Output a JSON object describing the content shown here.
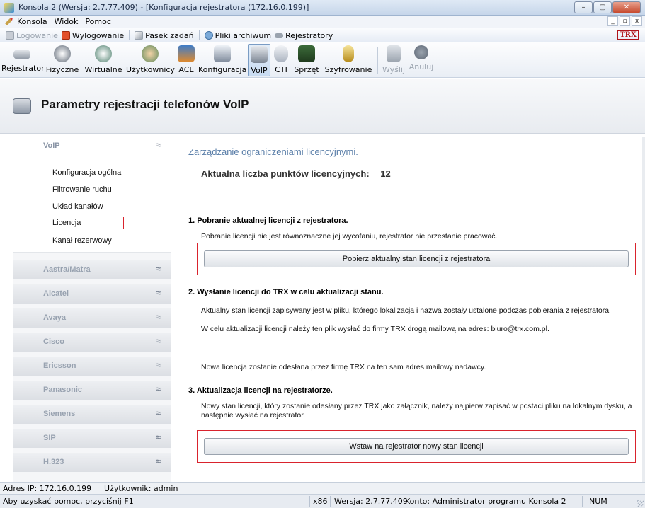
{
  "window": {
    "title": "Konsola 2 (Wersja: 2.7.77.409) - [Konfiguracja rejestratora (172.16.0.199)]",
    "buttons": [
      "–",
      "▢",
      "✕"
    ]
  },
  "menu": {
    "items": [
      "Konsola",
      "Widok",
      "Pomoc"
    ],
    "mdi_buttons": [
      "_",
      "▫",
      "x"
    ]
  },
  "quick_toolbar": {
    "login": "Logowanie",
    "logout": "Wylogowanie",
    "taskbar": "Pasek zadań",
    "archive": "Pliki archiwum",
    "recorders": "Rejestratory",
    "logo": "TRX"
  },
  "toolbar": {
    "rejestrator": "Rejestrator",
    "fizyczne": "Fizyczne",
    "wirtualne": "Wirtualne",
    "uzytkownicy": "Użytkownicy",
    "acl": "ACL",
    "konfiguracja": "Konfiguracja",
    "voip": "VoIP",
    "cti": "CTI",
    "sprzet": "Sprzęt",
    "szyfrowanie": "Szyfrowanie",
    "wyslij": "Wyślij",
    "anuluj": "Anuluj"
  },
  "header": {
    "title": "Parametry rejestracji telefonów VoIP"
  },
  "sidebar": {
    "open_group": "VoIP",
    "items": [
      "Konfiguracja ogólna",
      "Filtrowanie ruchu",
      "Układ kanałów",
      "Licencja",
      "Kanał rezerwowy"
    ],
    "selected": "Licencja",
    "groups": [
      "Aastra/Matra",
      "Alcatel",
      "Avaya",
      "Cisco",
      "Ericsson",
      "Panasonic",
      "Siemens",
      "SIP",
      "H.323"
    ],
    "collapse_glyph": "≈",
    "expand_glyph": "≈"
  },
  "main": {
    "title": "Zarządzanie ograniczeniami licencyjnymi.",
    "license_label": "Aktualna liczba punktów licencyjnych:",
    "license_value": "12",
    "sec1_title": "1. Pobranie aktualnej licencji z rejestratora.",
    "sec1_text": "Pobranie licencji nie jest równoznaczne jej wycofaniu, rejestrator nie przestanie pracować.",
    "btn_download": "Pobierz aktualny stan licencji z rejestratora",
    "sec2_title": "2. Wysłanie licencji do TRX w celu aktualizacji stanu.",
    "sec2_text1": "Aktualny stan licencji zapisywany jest w pliku, którego lokalizacja i nazwa zostały ustalone podczas pobierania z rejestratora.",
    "sec2_text2": "W celu aktualizacji licencji należy ten plik wysłać do firmy TRX drogą mailową na adres: biuro@trx.com.pl.",
    "sec2_text3": "Nowa licencja zostanie odesłana przez firmę TRX na ten sam adres mailowy nadawcy.",
    "sec3_title": "3. Aktualizacja licencji na rejestratorze.",
    "sec3_text": "Nowy stan licencji, który zostanie odesłany przez TRX jako załącznik, należy najpierw zapisać w postaci pliku na lokalnym dysku, a następnie wysłać na rejestrator.",
    "btn_upload": "Wstaw na rejestrator nowy stan licencji"
  },
  "status": {
    "ip": "Adres IP: 172.16.0.199",
    "user": "Użytkownik: admin",
    "help": "Aby uzyskać pomoc, przyciśnij F1",
    "arch": "x86",
    "version": "Wersja: 2.7.77.409",
    "account": "Konto: Administrator programu Konsola 2",
    "num": "NUM"
  }
}
